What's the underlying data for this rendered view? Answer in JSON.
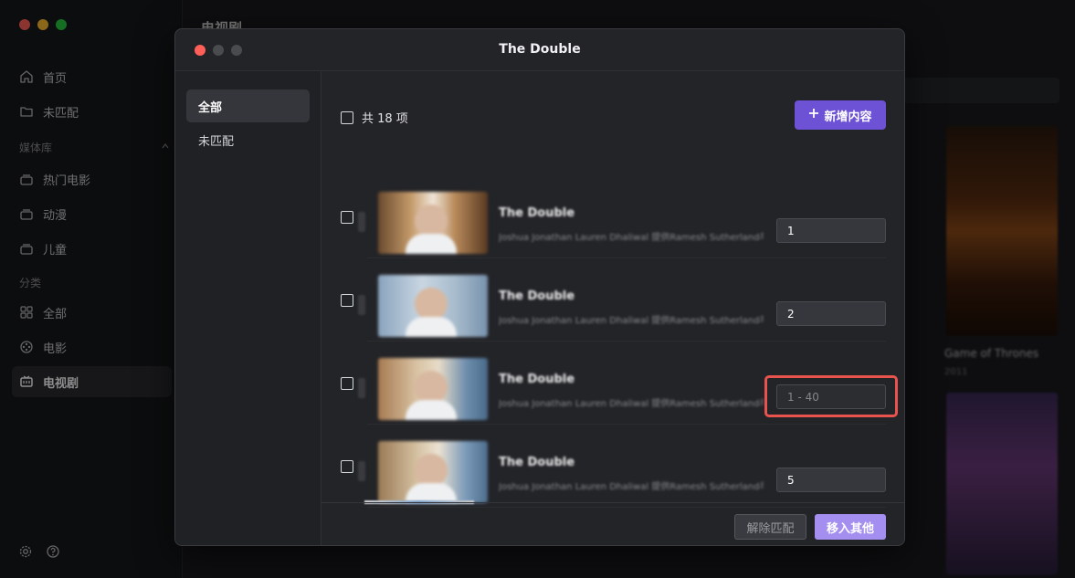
{
  "app": {
    "window_dots": [
      "#ff5f57",
      "#febc2e",
      "#28c840"
    ],
    "bg_title": "电视剧",
    "bg_caption": "Game of Thrones",
    "bg_sub": "2011"
  },
  "sidebar": {
    "items_top": [
      {
        "label": "首页",
        "icon": "home-icon"
      },
      {
        "label": "未匹配",
        "icon": "folder-icon"
      }
    ],
    "section_library": "媒体库",
    "library_items": [
      {
        "label": "热门电影",
        "icon": "stack-icon"
      },
      {
        "label": "动漫",
        "icon": "stack-icon"
      },
      {
        "label": "儿童",
        "icon": "stack-icon"
      }
    ],
    "section_category": "分类",
    "category_items": [
      {
        "label": "全部",
        "icon": "grid-icon"
      },
      {
        "label": "电影",
        "icon": "film-reel-icon"
      },
      {
        "label": "电视剧",
        "icon": "tv-icon"
      }
    ],
    "active": "电视剧",
    "bottom_icons": [
      "gear-icon",
      "help-icon"
    ]
  },
  "modal": {
    "title": "The Double",
    "window_dots": [
      "#ff5f57",
      "#4a4b4f",
      "#4a4b4f"
    ],
    "left_nav": [
      {
        "label": "全部",
        "active": true
      },
      {
        "label": "未匹配",
        "active": false
      }
    ],
    "select_all_label": "共 18 项",
    "add_button_label": "新增内容",
    "rows": [
      {
        "title": "The Double",
        "desc": "Joshua Jonathan Lauren Dhaliwal 提供Ramesh Sutherland与未来的…",
        "episode": "1",
        "placeholder": ""
      },
      {
        "title": "The Double",
        "desc": "Joshua Jonathan Lauren Dhaliwal 提供Ramesh Sutherland与未来的…",
        "episode": "2",
        "placeholder": ""
      },
      {
        "title": "The Double",
        "desc": "Joshua Jonathan Lauren Dhaliwal 提供Ramesh Sutherland与未来的…",
        "episode": "",
        "placeholder": "1 - 40"
      },
      {
        "title": "The Double",
        "desc": "Joshua Jonathan Lauren Dhaliwal 提供Ramesh Sutherland与未来的…",
        "episode": "5",
        "placeholder": ""
      }
    ],
    "footer": {
      "unmatch_label": "解除匹配",
      "move_label": "移入其他"
    },
    "colors": {
      "accent": "#6e52d6",
      "accent_light": "#a48ef0",
      "highlight": "#e8534e"
    }
  }
}
